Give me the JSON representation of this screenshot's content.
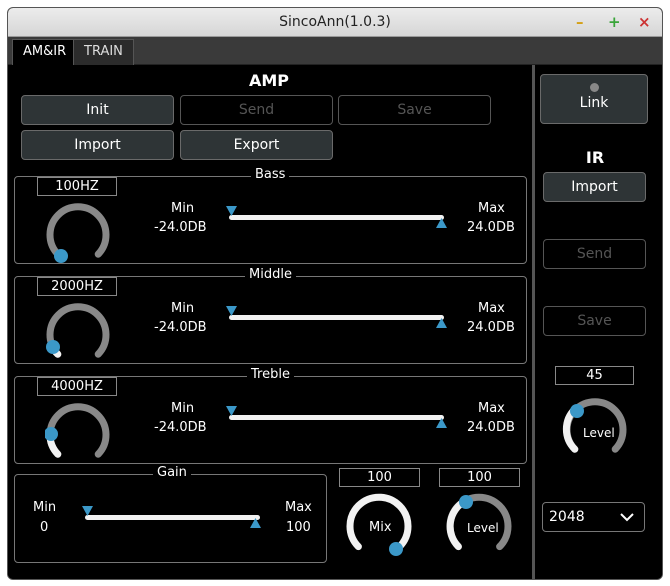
{
  "window": {
    "title": "SincoAnn(1.0.3)",
    "controls": [
      "–",
      "+",
      "×"
    ]
  },
  "tabs": [
    {
      "label": "AM&IR",
      "active": true
    },
    {
      "label": "TRAIN",
      "active": false
    }
  ],
  "amp": {
    "heading": "AMP",
    "buttons": {
      "init": "Init",
      "send": "Send",
      "save": "Save",
      "import": "Import",
      "export": "Export"
    },
    "bass": {
      "title": "Bass",
      "freq": "100HZ",
      "min_label": "Min",
      "min_value": "-24.0DB",
      "max_label": "Max",
      "max_value": "24.0DB"
    },
    "middle": {
      "title": "Middle",
      "freq": "2000HZ",
      "min_label": "Min",
      "min_value": "-24.0DB",
      "max_label": "Max",
      "max_value": "24.0DB"
    },
    "treble": {
      "title": "Treble",
      "freq": "4000HZ",
      "min_label": "Min",
      "min_value": "-24.0DB",
      "max_label": "Max",
      "max_value": "24.0DB"
    },
    "gain": {
      "title": "Gain",
      "min_label": "Min",
      "min_value": "0",
      "max_label": "Max",
      "max_value": "100"
    },
    "mix": {
      "label": "Mix",
      "value": "100"
    },
    "level": {
      "label": "Level",
      "value": "100"
    }
  },
  "ir": {
    "link_label": "Link",
    "heading": "IR",
    "buttons": {
      "import": "Import",
      "send": "Send",
      "save": "Save"
    },
    "level": {
      "label": "Level",
      "value": "45"
    },
    "size_select": "2048"
  },
  "colors": {
    "accent": "#3b98c8",
    "background": "#000000",
    "knob_track": "#888888",
    "knob_fill": "#f2f2f2"
  }
}
